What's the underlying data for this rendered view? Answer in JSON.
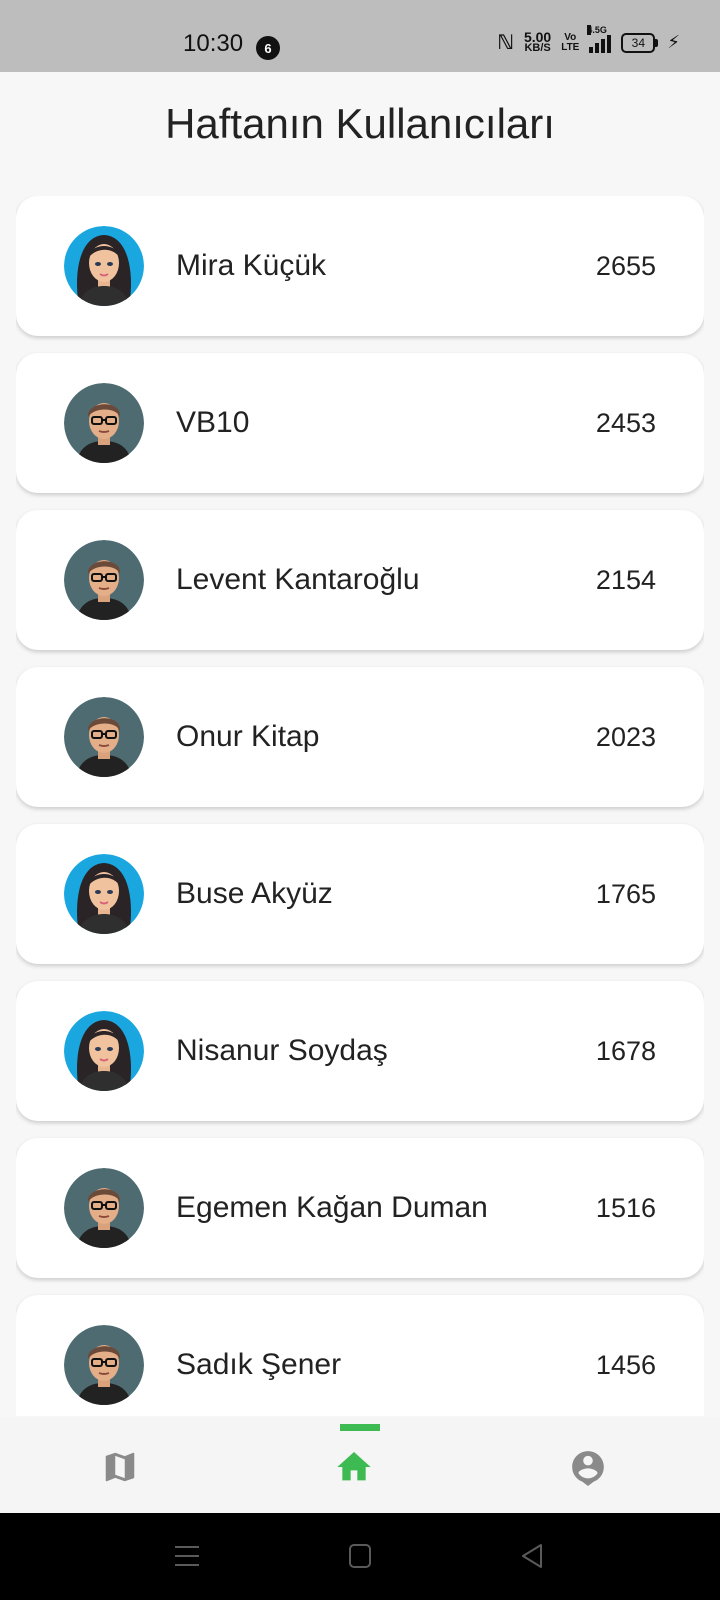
{
  "status_bar": {
    "time": "10:30",
    "notification_count": "6",
    "net_speed_value": "5.00",
    "net_speed_unit": "KB/S",
    "volte_line1": "Vo",
    "volte_line2": "LTE",
    "signal_label": "4.5G",
    "battery": "34"
  },
  "page": {
    "title": "Haftanın Kullanıcıları"
  },
  "users": [
    {
      "name": "Mira Küçük",
      "score": "2655",
      "avatar": "female-avatar"
    },
    {
      "name": "VB10",
      "score": "2453",
      "avatar": "male-avatar"
    },
    {
      "name": "Levent Kantaroğlu",
      "score": "2154",
      "avatar": "male-avatar"
    },
    {
      "name": "Onur Kitap",
      "score": "2023",
      "avatar": "male-avatar"
    },
    {
      "name": "Buse Akyüz",
      "score": "1765",
      "avatar": "female-avatar"
    },
    {
      "name": "Nisanur Soydaş",
      "score": "1678",
      "avatar": "female-avatar"
    },
    {
      "name": "Egemen Kağan Duman",
      "score": "1516",
      "avatar": "male-avatar"
    },
    {
      "name": "Sadık Şener",
      "score": "1456",
      "avatar": "male-avatar"
    }
  ],
  "bottom_nav": {
    "items": [
      {
        "icon": "map-icon",
        "active": false
      },
      {
        "icon": "home-icon",
        "active": true
      },
      {
        "icon": "profile-icon",
        "active": false
      }
    ],
    "active_color": "#3dbb52",
    "inactive_color": "#8a8a8a"
  },
  "system_nav": {
    "buttons": [
      "menu-icon",
      "home-square-icon",
      "back-triangle-icon"
    ]
  }
}
